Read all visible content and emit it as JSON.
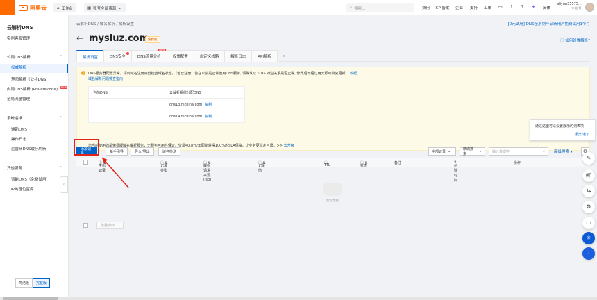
{
  "topbar": {
    "logo_text": "阿里云",
    "workbench": "工作台",
    "resource_scope": "账号全部资源",
    "search_placeholder": "搜索...",
    "nav": [
      "费用",
      "ICP 备案",
      "企业",
      "支持",
      "工单"
    ],
    "lang": "简体",
    "username": "aliyun35575...",
    "account_type": "主账号"
  },
  "sidebar": {
    "title": "云解析DNS",
    "items": [
      {
        "label": "实例客服管理"
      },
      {
        "label": "公网DNS解析"
      },
      {
        "label": "权威解析"
      },
      {
        "label": "递归解析（公共DNS）"
      },
      {
        "label": "内网DNS解析 (PrivateZone)",
        "badge": "NEW"
      },
      {
        "label": "全局流量管理"
      },
      {
        "label": "系统运维"
      },
      {
        "label": "辅助DNS"
      },
      {
        "label": "操作日志"
      },
      {
        "label": "运营商DNS缓存刷新"
      },
      {
        "label": "其他服务"
      },
      {
        "label": "智能DNS（免费试用）"
      },
      {
        "label": "IP地理位置库"
      }
    ],
    "version": {
      "simple": "简洁版",
      "full": "完整版"
    }
  },
  "main": {
    "breadcrumb": "云解析DNS  /  域名解析  /  解析设置",
    "promo": "[0元试用] DNS全系列产品新用户免费试用1个月",
    "domain": "mysluz.com",
    "domain_tag": "免费版",
    "howto": "如何设置解析?",
    "tabs": [
      {
        "label": "解析设置"
      },
      {
        "label": "DNS安全",
        "dot": true
      },
      {
        "label": "DNS流量分析",
        "badge": "NEW"
      },
      {
        "label": "权重配置"
      },
      {
        "label": "自定义线路"
      },
      {
        "label": "解析日志"
      },
      {
        "label": "API解析"
      }
    ],
    "notice": {
      "text": "DNS服务器配置异常，请到域名注册商处检查域名状态。（若已注册，若在以前是正常使用DNS服务, 请确认以下 NS 对应关系是否正确, 修改后不超过两天即可恢复更新）",
      "link1": "收起",
      "link2": "域名解析问题排查指南",
      "header_current": "当前DNS",
      "header_assigned": "云解析系统分配DNS",
      "dns1": "dns13.hichina.com",
      "dns2": "dns14.hichina.com",
      "copy": "复制",
      "upgrade_text": "您当前使用的是免费版域名解析服务，无服务可用性保证。仅需40.8元/年即能获得100%的SLA保障，让业务更稳定可靠。>>",
      "upgrade_link": "去升级"
    },
    "toolbar": {
      "add": "添加记录",
      "new_guide": "新手引导",
      "import_export": "导入/导出",
      "check": "域名检测",
      "all_records": "全部记录",
      "precise": "精确搜索",
      "keyword_placeholder": "输入关键字",
      "advanced": "高级搜索"
    },
    "table_headers": [
      "主机记录",
      "记录类型",
      "解析请求来源(isp)",
      "记录值",
      "TTL",
      "状态",
      "备注",
      "创建时间",
      "操作"
    ],
    "empty_text": "暂无数据",
    "batch": "批量操作",
    "tooltip": {
      "text": "通过这里可以设置展示的列表项",
      "ok": "我知道了"
    }
  },
  "colors": {
    "brand": "#ff6a00",
    "primary": "#0064c8",
    "highlight": "#e3231a"
  }
}
